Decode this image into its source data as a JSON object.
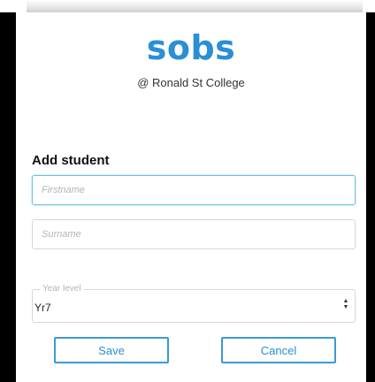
{
  "brand": {
    "logo": "sobs",
    "school": "@ Ronald St College",
    "accent": "#2a8fd6"
  },
  "form": {
    "title": "Add student",
    "firstname_placeholder": "Firstname",
    "surname_placeholder": "Surname",
    "year_level_label": "Year level",
    "year_level_value": "Yr7",
    "save_label": "Save",
    "cancel_label": "Cancel"
  }
}
